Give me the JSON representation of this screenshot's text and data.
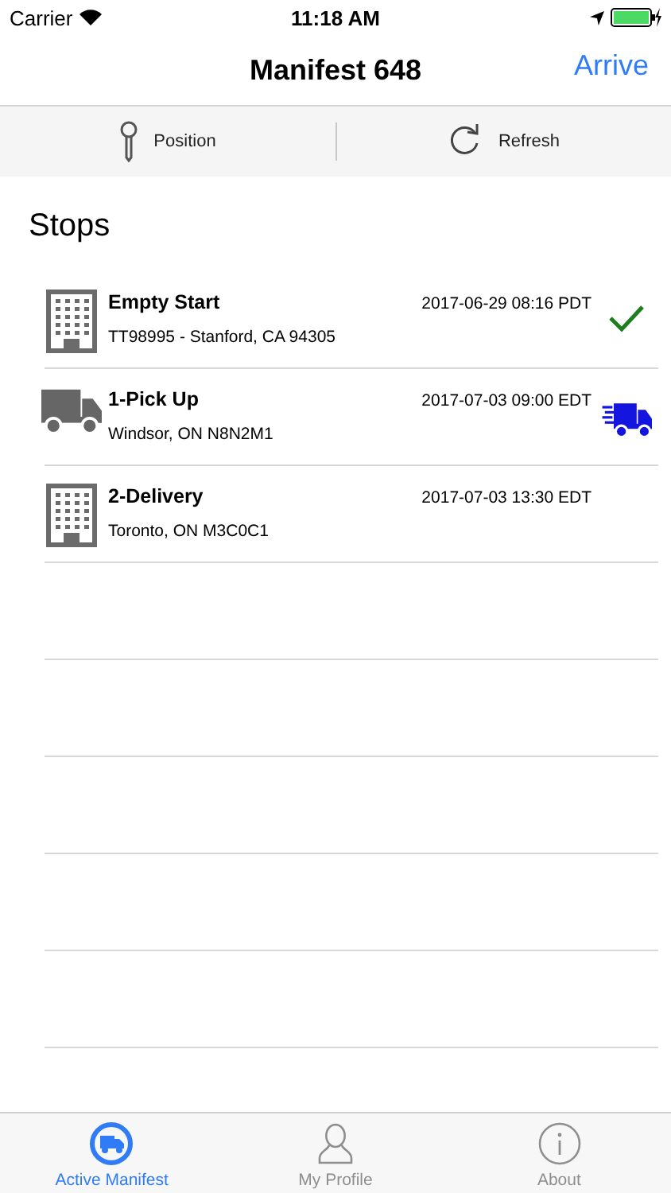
{
  "status_bar": {
    "carrier": "Carrier",
    "time": "11:18 AM"
  },
  "nav": {
    "title": "Manifest 648",
    "action": "Arrive"
  },
  "toolbar": [
    {
      "kind": "position",
      "label": "Position"
    },
    {
      "kind": "refresh",
      "label": "Refresh"
    }
  ],
  "section_title": "Stops",
  "stops": [
    {
      "kind": "building",
      "name": "Empty Start",
      "address": "TT98995 - Stanford, CA 94305",
      "time": "2017-06-29 08:16 PDT",
      "completed": true,
      "in_transit": false
    },
    {
      "kind": "truck",
      "name": "1-Pick Up",
      "address": "Windsor, ON N8N2M1",
      "time": "2017-07-03 09:00 EDT",
      "completed": false,
      "in_transit": true
    },
    {
      "kind": "building",
      "name": "2-Delivery",
      "address": "Toronto, ON M3C0C1",
      "time": "2017-07-03 13:30 EDT",
      "completed": false,
      "in_transit": false
    }
  ],
  "tabs": [
    {
      "kind": "manifest",
      "label": "Active Manifest",
      "selected": true
    },
    {
      "kind": "profile",
      "label": "My Profile",
      "selected": false
    },
    {
      "kind": "about",
      "label": "About",
      "selected": false
    }
  ]
}
